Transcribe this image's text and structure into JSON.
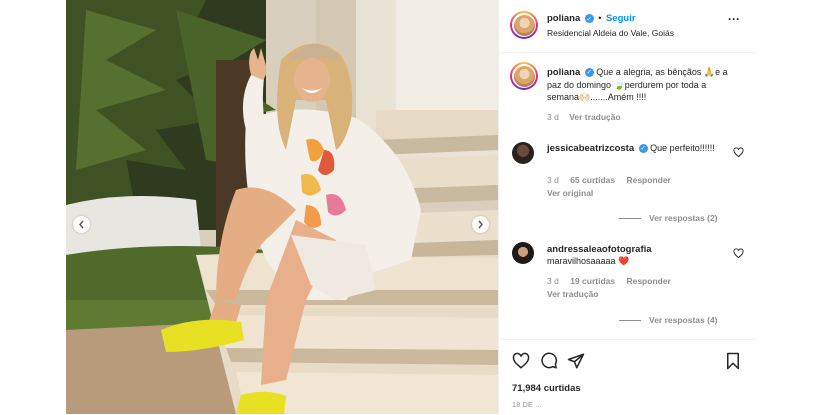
{
  "post": {
    "author": "poliana",
    "follow_label": "Seguir",
    "location": "Residencial Aldeia do Vale, Goiás",
    "more_icon": "more-dots-icon",
    "caption_text": "Que a alegria, as bênçãos 🙏e a paz do domingo 🍃perdurem por toda a semana🙌🏻.......Amém !!!!",
    "caption_time": "3 d",
    "caption_translation": "Ver tradução",
    "likes": "71,984 curtidas",
    "date": "18 DE ..."
  },
  "comments": [
    {
      "user": "jessicabeatrizcosta",
      "verified": true,
      "text": "Que perfeito!!!!!!",
      "time": "3 d",
      "likes": "65 curtidas",
      "reply": "Responder",
      "extra": "Ver original",
      "view_replies": "Ver respostas (2)"
    },
    {
      "user": "andressaleaofotografia",
      "verified": false,
      "text": "maravilhosaaaaa ❤️",
      "time": "3 d",
      "likes": "19 curtidas",
      "reply": "Responder",
      "extra": "Ver tradução",
      "view_replies": "Ver respostas (4)"
    }
  ],
  "icons": {
    "like": "heart-icon",
    "comment": "comment-icon",
    "share": "share-icon",
    "save": "bookmark-icon",
    "prev": "chevron-left-icon",
    "next": "chevron-right-icon"
  },
  "colors": {
    "accent": "#0095f6",
    "verified": "#3897f0",
    "muted": "#8e8e8e",
    "border": "#efefef"
  }
}
